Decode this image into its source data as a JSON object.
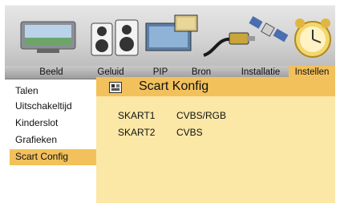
{
  "tabs": [
    {
      "label": "Beeld"
    },
    {
      "label": "Geluid"
    },
    {
      "label": "PIP"
    },
    {
      "label": "Bron"
    },
    {
      "label": "Installatie"
    },
    {
      "label": "Instellen",
      "active": true
    }
  ],
  "menu": {
    "items": [
      {
        "label": "Talen"
      },
      {
        "label": "Uitschakeltijd"
      },
      {
        "label": "Kinderslot"
      },
      {
        "label": "Grafieken"
      },
      {
        "label": "Scart Config",
        "selected": true
      }
    ]
  },
  "panel": {
    "title": "Scart Konfig",
    "rows": [
      {
        "label": "SKART1",
        "value": "CVBS/RGB"
      },
      {
        "label": "SKART2",
        "value": "CVBS"
      }
    ]
  },
  "icons": [
    "tv-icon",
    "speaker-icon",
    "pip-icon",
    "cable-icon",
    "satellite-icon",
    "clock-icon",
    "scart-icon"
  ],
  "colors": {
    "accent": "#f2c15c",
    "panel_bg": "#fbe7a6"
  }
}
